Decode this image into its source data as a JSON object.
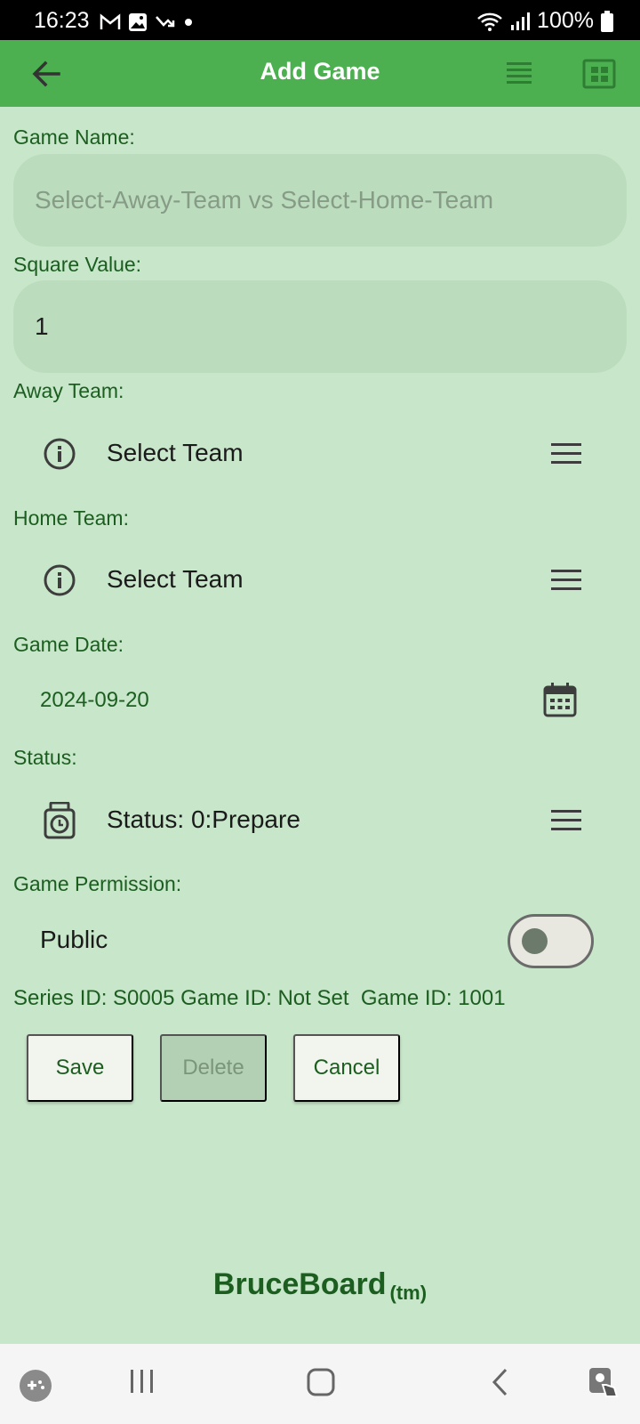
{
  "status_bar": {
    "time": "16:23",
    "battery": "100%"
  },
  "app_bar": {
    "title": "Add Game"
  },
  "form": {
    "game_name_label": "Game Name:",
    "game_name_placeholder": "Select-Away-Team vs Select-Home-Team",
    "square_value_label": "Square Value:",
    "square_value": "1",
    "away_team_label": "Away Team:",
    "away_team_value": "Select Team",
    "home_team_label": "Home Team:",
    "home_team_value": "Select Team",
    "game_date_label": "Game Date:",
    "game_date_value": "2024-09-20",
    "status_label": "Status:",
    "status_value": "Status: 0:Prepare",
    "permission_label": "Game Permission:",
    "permission_value": "Public",
    "permission_enabled": false,
    "ids_text": "Series ID: S0005 Game ID: Not Set  Game ID: 1001"
  },
  "buttons": {
    "save": "Save",
    "delete": "Delete",
    "cancel": "Cancel"
  },
  "brand": {
    "name": "BruceBoard",
    "tm": "(tm)"
  },
  "colors": {
    "app_bar": "#4caf50",
    "background": "#c8e6c9",
    "label_text": "#1b5e20"
  }
}
